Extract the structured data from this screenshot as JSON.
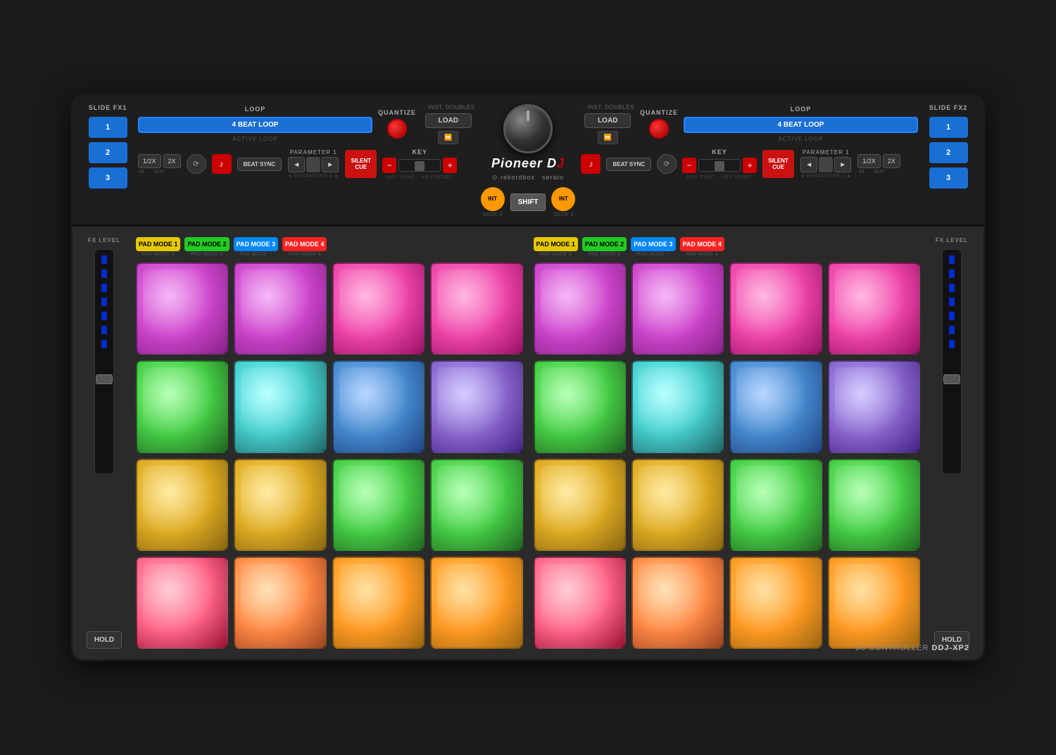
{
  "controller": {
    "model": "DDJ-XP2",
    "type": "DJ CONTROLLER",
    "brand": "Pioneer DJ",
    "brand_italic": true,
    "logos": [
      "rekordbox",
      "serato"
    ]
  },
  "slide_fx1": {
    "label": "SLIDE FX1",
    "buttons": [
      "1",
      "2",
      "3"
    ]
  },
  "slide_fx2": {
    "label": "SLIDE FX2",
    "buttons": [
      "1",
      "2",
      "3"
    ]
  },
  "deck_left": {
    "loop_label": "LOOP",
    "beat_loop_btn": "4 BEAT LOOP",
    "active_loop_label": "ACTIVE LOOP",
    "quantize_label": "QUANTIZE",
    "inst_doubles_label": "·· INST. DOUBLES",
    "load_btn": "LOAD",
    "param1_label": "PARAMETER 1",
    "param2_label": "◄ PARAMETER 2 ►",
    "silent_cue": "SILENT CUE",
    "key_label": "KEY",
    "key_sync_label": "KEY SYNC",
    "key_reset_label": "KEY RESET",
    "beat_sync_label": "BEAT SYNC",
    "half_btn": "1/2X",
    "two_x_btn": "2X",
    "in_label": "IN",
    "out_label": "OUT",
    "deck_label": "DECK 3"
  },
  "deck_right": {
    "loop_label": "LOOP",
    "beat_loop_btn": "4 BEAT LOOP",
    "active_loop_label": "ACTIVE LOOP",
    "quantize_label": "QUANTIZE",
    "inst_doubles_label": "·· INST. DOUBLES",
    "load_btn": "LOAD",
    "param1_label": "PARAMETER 1",
    "param2_label": "◄ PARAMETER 2 ►",
    "silent_cue": "SILENT CUE",
    "key_label": "KEY",
    "key_sync_label": "KEY SYNC",
    "key_reset_label": "KEY RESET",
    "beat_sync_label": "BEAT SYNC",
    "half_btn": "1/2X",
    "two_x_btn": "2X",
    "in_label": "IN",
    "out_label": "OUT",
    "deck_label": "DECK 4"
  },
  "center": {
    "shift_btn": "SHIFT",
    "deck3_label": "DECK 3",
    "deck4_label": "DECK 4"
  },
  "fx_level_left": {
    "label": "FX LEVEL",
    "hold_btn": "HOLD"
  },
  "fx_level_right": {
    "label": "FX LEVEL",
    "hold_btn": "HOLD"
  },
  "pads_left": {
    "modes": [
      {
        "label": "PAD MODE 1",
        "sub": "PAD MODE 5",
        "color": "#e6c800"
      },
      {
        "label": "PAD MODE 2",
        "sub": "PAD MODE 6",
        "color": "#22cc22"
      },
      {
        "label": "PAD MODE 3",
        "sub": "PAD MODE 7",
        "color": "#0088ff"
      },
      {
        "label": "PAD MODE 4",
        "sub": "PAD MODE 8",
        "color": "#ff2222"
      }
    ],
    "rows": [
      [
        {
          "color": "#cc44cc",
          "bg": "radial-gradient(circle at 35% 35%, #ee88ee, #cc44cc, #882288)"
        },
        {
          "color": "#cc44cc",
          "bg": "radial-gradient(circle at 35% 35%, #ee88ee, #cc44cc, #882288)"
        },
        {
          "color": "#ee44aa",
          "bg": "radial-gradient(circle at 35% 35%, #ff88cc, #ee44aa, #991166)"
        },
        {
          "color": "#ee44aa",
          "bg": "radial-gradient(circle at 35% 35%, #ff88cc, #ee44aa, #991166)"
        }
      ],
      [
        {
          "color": "#44cc44",
          "bg": "radial-gradient(circle at 35% 35%, #88ff88, #44cc44, #226622)"
        },
        {
          "color": "#44cccc",
          "bg": "radial-gradient(circle at 35% 35%, #88ffff, #44cccc, #226666)"
        },
        {
          "color": "#4488cc",
          "bg": "radial-gradient(circle at 35% 35%, #88bbff, #4488cc, #224488)"
        },
        {
          "color": "#8866cc",
          "bg": "radial-gradient(circle at 35% 35%, #bbaaff, #8866cc, #442288)"
        }
      ],
      [
        {
          "color": "#ddaa22",
          "bg": "radial-gradient(circle at 35% 35%, #ffdd66, #ddaa22, #886611)"
        },
        {
          "color": "#ddaa22",
          "bg": "radial-gradient(circle at 35% 35%, #ffdd66, #ddaa22, #886611)"
        },
        {
          "color": "#44cc44",
          "bg": "radial-gradient(circle at 35% 35%, #88ff88, #44cc44, #226622)"
        },
        {
          "color": "#44cc44",
          "bg": "radial-gradient(circle at 35% 35%, #88ff88, #44cc44, #226622)"
        }
      ],
      [
        {
          "color": "#ff6688",
          "bg": "radial-gradient(circle at 35% 35%, #ffaabb, #ff6688, #991133)"
        },
        {
          "color": "#ff8844",
          "bg": "radial-gradient(circle at 35% 35%, #ffcc88, #ff8844, #994422)"
        },
        {
          "color": "#ff9922",
          "bg": "radial-gradient(circle at 35% 35%, #ffcc66, #ff9922, #996611)"
        },
        {
          "color": "#ff9922",
          "bg": "radial-gradient(circle at 35% 35%, #ffcc66, #ff9922, #996611)"
        }
      ]
    ]
  },
  "pads_right": {
    "modes": [
      {
        "label": "PAD MODE 1",
        "sub": "PAD MODE 5",
        "color": "#e6c800"
      },
      {
        "label": "PAD MODE 2",
        "sub": "PAD MODE 6",
        "color": "#22cc22"
      },
      {
        "label": "PAD MODE 3",
        "sub": "PAD MODE 7",
        "color": "#0088ff"
      },
      {
        "label": "PAD MODE 4",
        "sub": "PAD MODE 8",
        "color": "#ff2222"
      }
    ],
    "rows": [
      [
        {
          "color": "#cc44cc",
          "bg": "radial-gradient(circle at 35% 35%, #ee88ee, #cc44cc, #882288)"
        },
        {
          "color": "#cc44cc",
          "bg": "radial-gradient(circle at 35% 35%, #ee88ee, #cc44cc, #882288)"
        },
        {
          "color": "#ee44aa",
          "bg": "radial-gradient(circle at 35% 35%, #ff88cc, #ee44aa, #991166)"
        },
        {
          "color": "#ee44aa",
          "bg": "radial-gradient(circle at 35% 35%, #ff88cc, #ee44aa, #991166)"
        }
      ],
      [
        {
          "color": "#44cc44",
          "bg": "radial-gradient(circle at 35% 35%, #88ff88, #44cc44, #226622)"
        },
        {
          "color": "#44cccc",
          "bg": "radial-gradient(circle at 35% 35%, #88ffff, #44cccc, #226666)"
        },
        {
          "color": "#4488cc",
          "bg": "radial-gradient(circle at 35% 35%, #88bbff, #4488cc, #224488)"
        },
        {
          "color": "#8866cc",
          "bg": "radial-gradient(circle at 35% 35%, #bbaaff, #8866cc, #442288)"
        }
      ],
      [
        {
          "color": "#ddaa22",
          "bg": "radial-gradient(circle at 35% 35%, #ffdd66, #ddaa22, #886611)"
        },
        {
          "color": "#ddaa22",
          "bg": "radial-gradient(circle at 35% 35%, #ffdd66, #ddaa22, #886611)"
        },
        {
          "color": "#44cc44",
          "bg": "radial-gradient(circle at 35% 35%, #88ff88, #44cc44, #226622)"
        },
        {
          "color": "#44cc44",
          "bg": "radial-gradient(circle at 35% 35%, #88ff88, #44cc44, #226622)"
        }
      ],
      [
        {
          "color": "#ff6688",
          "bg": "radial-gradient(circle at 35% 35%, #ffaabb, #ff6688, #991133)"
        },
        {
          "color": "#ff8844",
          "bg": "radial-gradient(circle at 35% 35%, #ffcc88, #ff8844, #994422)"
        },
        {
          "color": "#ff9922",
          "bg": "radial-gradient(circle at 35% 35%, #ffcc66, #ff9922, #996611)"
        },
        {
          "color": "#ff9922",
          "bg": "radial-gradient(circle at 35% 35%, #ffcc66, #ff9922, #996611)"
        }
      ]
    ]
  }
}
